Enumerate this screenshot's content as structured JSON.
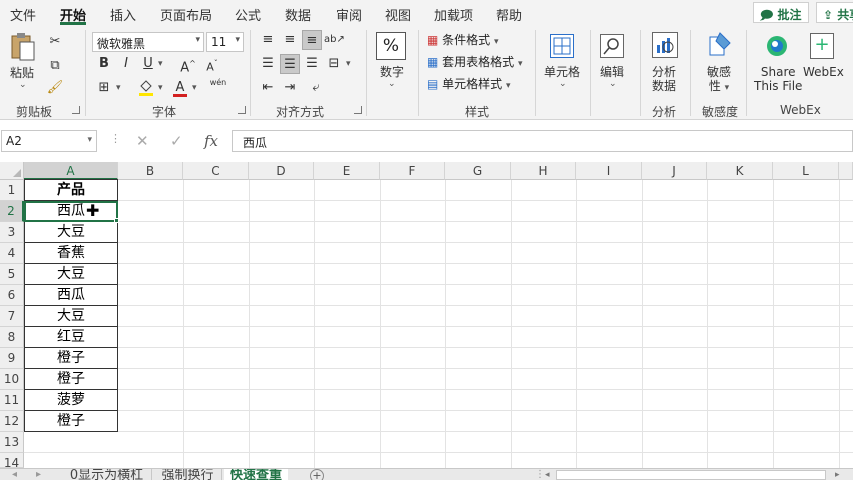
{
  "menu": {
    "tabs": [
      "文件",
      "开始",
      "插入",
      "页面布局",
      "公式",
      "数据",
      "审阅",
      "视图",
      "加载项",
      "帮助"
    ],
    "active_tab": "开始",
    "comment_btn": "批注",
    "share_btn": "共享"
  },
  "ribbon": {
    "clipboard": {
      "label": "剪贴板",
      "paste": "粘贴"
    },
    "font": {
      "label": "字体",
      "font_name": "微软雅黑",
      "font_size": "11",
      "bold": "B",
      "italic": "I",
      "underline": "U",
      "grow": "A",
      "shrink": "A",
      "font_color": "A",
      "phonetic": "wén"
    },
    "alignment": {
      "label": "对齐方式"
    },
    "number": {
      "label": "数字",
      "button": "数字"
    },
    "styles": {
      "label": "样式",
      "conditional": "条件格式",
      "table": "套用表格格式",
      "cell_styles": "单元格样式"
    },
    "cells": {
      "button": "单元格"
    },
    "editing": {
      "button": "编辑"
    },
    "analysis": {
      "label": "分析",
      "button_line1": "分析",
      "button_line2": "数据"
    },
    "sensitivity": {
      "label": "敏感度",
      "button_line1": "敏感",
      "button_line2": "性"
    },
    "webex": {
      "label": "WebEx",
      "share_line1": "Share",
      "share_line2": "This File",
      "webex_btn": "WebEx"
    }
  },
  "formula_bar": {
    "name_box": "A2",
    "cancel": "✕",
    "enter": "✓",
    "fx": "fx",
    "value": "西瓜"
  },
  "grid": {
    "columns": [
      "A",
      "B",
      "C",
      "D",
      "E",
      "F",
      "G",
      "H",
      "I",
      "J",
      "K",
      "L"
    ],
    "rows": [
      "1",
      "2",
      "3",
      "4",
      "5",
      "6",
      "7",
      "8",
      "9",
      "10",
      "11",
      "12",
      "13",
      "14"
    ],
    "active_cell": "A2",
    "cells": [
      "产品",
      "西瓜",
      "大豆",
      "香蕉",
      "大豆",
      "西瓜",
      "大豆",
      "红豆",
      "橙子",
      "橙子",
      "菠萝",
      "橙子"
    ]
  },
  "sheet_tabs": {
    "tabs": [
      "0显示为横杠",
      "强制换行",
      "快速查重"
    ],
    "active": "快速查重",
    "add": "+"
  },
  "colors": {
    "accent": "#217346",
    "ribbon_bg": "#f3f3f3",
    "font_red": "#d32020"
  }
}
